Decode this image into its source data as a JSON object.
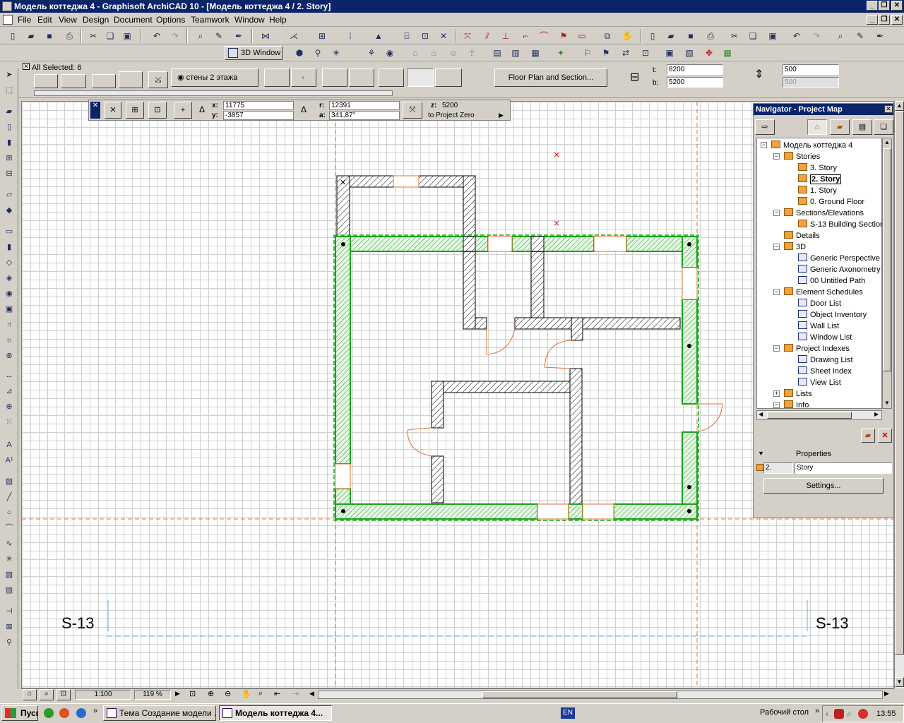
{
  "window": {
    "title": "Модель коттеджа 4 - Graphisoft ArchiCAD 10 - [Модель коттеджа 4 / 2. Story]",
    "min": "_",
    "restore": "❐",
    "close": "✕"
  },
  "menu": [
    "File",
    "Edit",
    "View",
    "Design",
    "Document",
    "Options",
    "Teamwork",
    "Window",
    "Help"
  ],
  "toolbar2": {
    "window3d": "3D Window"
  },
  "infobox": {
    "selection": "All Selected: 6",
    "layer_label": "стены 2 этажа",
    "floorplan_button": "Floor Plan and Section...",
    "t_label": "t:",
    "t_value": "8200",
    "b_label": "b:",
    "b_value": "5200",
    "height_value": "500",
    "height_value2": "500"
  },
  "coords": {
    "x_label": "x:",
    "x_value": "11775",
    "y_label": "y:",
    "y_value": "-3857",
    "r_label": "r:",
    "r_value": "12391",
    "a_label": "a:",
    "a_value": "341,87°",
    "z_label": "z:",
    "z_value": "5200",
    "ref": "to Project Zero"
  },
  "drawing": {
    "section_left": "S-13",
    "section_right": "S-13",
    "colors": {
      "wall_selected": "#1aa31a",
      "wall": "#000000",
      "door": "#e05a10",
      "guide": "#e07030",
      "section_line": "#6ab0e0"
    }
  },
  "navigator": {
    "title": "Navigator - Project Map",
    "tree": [
      {
        "label": "Модель коттеджа 4",
        "level": 0,
        "icon": "house-icon",
        "expander": "−"
      },
      {
        "label": "Stories",
        "level": 1,
        "icon": "stories-icon",
        "expander": "−"
      },
      {
        "label": "3. Story",
        "level": 2,
        "icon": "story-icon"
      },
      {
        "label": "2. Story",
        "level": 2,
        "icon": "story-icon",
        "selected": true
      },
      {
        "label": "1. Story",
        "level": 2,
        "icon": "story-icon"
      },
      {
        "label": "0. Ground Floor",
        "level": 2,
        "icon": "story-icon"
      },
      {
        "label": "Sections/Elevations",
        "level": 1,
        "icon": "section-icon",
        "expander": "−"
      },
      {
        "label": "S-13 Building Section",
        "level": 2,
        "icon": "story-icon"
      },
      {
        "label": "Details",
        "level": 1,
        "icon": "details-icon"
      },
      {
        "label": "3D",
        "level": 1,
        "icon": "3d-icon",
        "expander": "−"
      },
      {
        "label": "Generic Perspective",
        "level": 2,
        "icon": "perspective-icon"
      },
      {
        "label": "Generic Axonometry",
        "level": 2,
        "icon": "axonometry-icon"
      },
      {
        "label": "00 Untitled Path",
        "level": 2,
        "icon": "path-icon"
      },
      {
        "label": "Element Schedules",
        "level": 1,
        "icon": "schedule-icon",
        "expander": "−"
      },
      {
        "label": "Door List",
        "level": 2,
        "icon": "list-icon"
      },
      {
        "label": "Object Inventory",
        "level": 2,
        "icon": "list-icon"
      },
      {
        "label": "Wall List",
        "level": 2,
        "icon": "list-icon"
      },
      {
        "label": "Window List",
        "level": 2,
        "icon": "list-icon"
      },
      {
        "label": "Project Indexes",
        "level": 1,
        "icon": "index-icon",
        "expander": "−"
      },
      {
        "label": "Drawing List",
        "level": 2,
        "icon": "list-icon"
      },
      {
        "label": "Sheet Index",
        "level": 2,
        "icon": "list-icon"
      },
      {
        "label": "View List",
        "level": 2,
        "icon": "list-icon"
      },
      {
        "label": "Lists",
        "level": 1,
        "icon": "list-icon",
        "expander": "+"
      },
      {
        "label": "Info",
        "level": 1,
        "icon": "info-icon",
        "expander": "−"
      }
    ],
    "properties_label": "Properties",
    "prop_number": "2.",
    "prop_name": "Story",
    "settings_button": "Settings..."
  },
  "status": {
    "scale": "1:100",
    "zoom": "119 %"
  },
  "taskbar": {
    "start": "Пуск",
    "tasks": [
      {
        "label": "Тема Создание модели ..."
      },
      {
        "label": "Модель коттеджа 4..."
      }
    ],
    "lang": "EN",
    "desktop": "Рабочий стол",
    "time": "13:55"
  }
}
